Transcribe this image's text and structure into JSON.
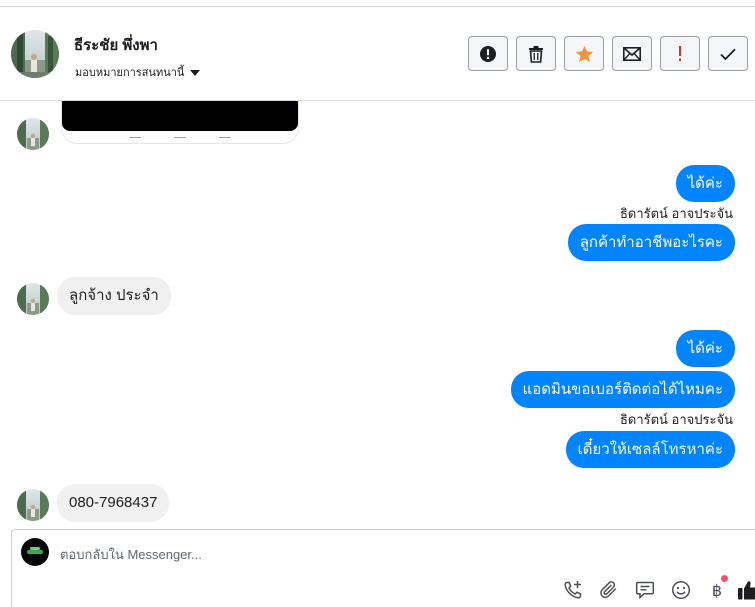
{
  "header": {
    "contact_name": "ธีระชัย พึ่งพา",
    "assign_label": "มอบหมายการสนทนานี้",
    "actions": [
      {
        "name": "spam-button",
        "icon": "exclamation-circle-icon"
      },
      {
        "name": "delete-button",
        "icon": "trash-icon"
      },
      {
        "name": "star-button",
        "icon": "star-icon",
        "color": "#f7923b"
      },
      {
        "name": "mark-unread-button",
        "icon": "envelope-icon"
      },
      {
        "name": "follow-up-button",
        "icon": "exclamation-icon",
        "color": "#e02929"
      },
      {
        "name": "mark-done-button",
        "icon": "check-icon"
      }
    ]
  },
  "messages": {
    "m1": "ได้ค่ะ",
    "sender1": "ธิดารัตน์ อาจประจัน",
    "m2": "ลูกค้าทำอาชีพอะไรคะ",
    "m3": "ลูกจ้าง ประจำ",
    "m4": "ได้ค่ะ",
    "m5": "แอดมินขอเบอร์ติดต่อได้ไหมคะ",
    "sender2": "ธิดารัตน์ อาจประจัน",
    "m6": "เดี๋ยวให้เซลล์โทรหาค่ะ",
    "m7": "080-7968437"
  },
  "composer": {
    "placeholder": "ตอบกลับใน Messenger...",
    "tools": [
      "add-call-icon",
      "paperclip-icon",
      "saved-reply-icon",
      "emoji-icon",
      "baht-icon",
      "thumbs-up-icon"
    ],
    "baht_symbol": "฿"
  },
  "colors": {
    "outgoing_bubble": "#0084ff",
    "incoming_bubble": "#f0f0f0",
    "star": "#f7923b",
    "alert": "#e02929",
    "notification_dot": "#f25268"
  }
}
